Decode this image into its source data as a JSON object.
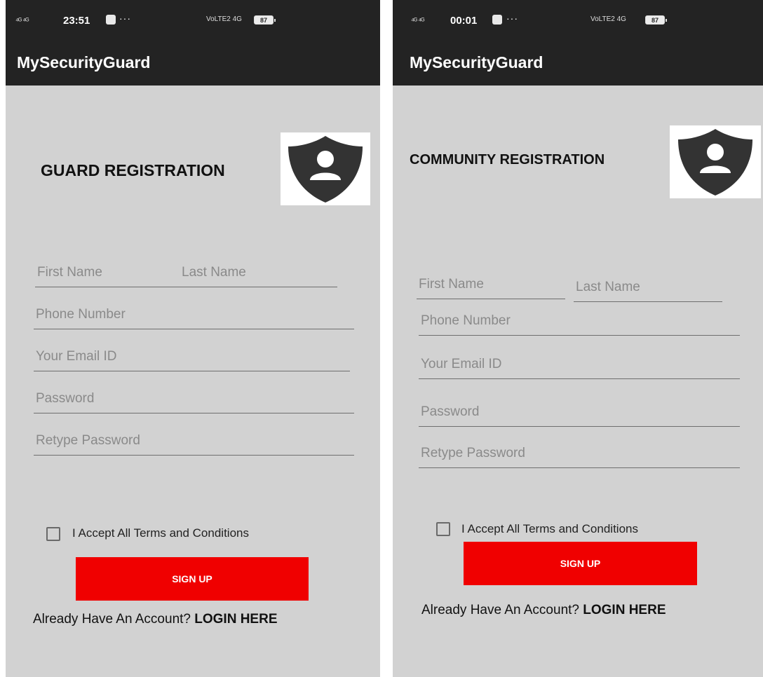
{
  "screens": [
    {
      "status": {
        "signal_left": "⁴ᴳ ⁴ᴳ",
        "time": "23:51",
        "dots": "···",
        "network": "VoLTE2 4G",
        "battery": "87"
      },
      "app_title": "MySecurityGuard",
      "heading": "GUARD REGISTRATION",
      "fields": {
        "first_name": "First Name",
        "last_name": "Last Name",
        "phone": "Phone Number",
        "email": "Your Email ID",
        "password": "Password",
        "retype": "Retype Password"
      },
      "terms": "I Accept All Terms and Conditions",
      "signup": "SIGN UP",
      "account_prompt": "Already Have An Account?",
      "login": "LOGIN HERE"
    },
    {
      "status": {
        "signal_left": "⁴ᴳ ⁴ᴳ",
        "time": "00:01",
        "dots": "···",
        "network": "VoLTE2 4G",
        "battery": "87"
      },
      "app_title": "MySecurityGuard",
      "heading": "COMMUNITY REGISTRATION",
      "fields": {
        "first_name": "First Name",
        "last_name": "Last Name",
        "phone": "Phone Number",
        "email": "Your Email ID",
        "password": "Password",
        "retype": "Retype Password"
      },
      "terms": "I Accept All Terms and Conditions",
      "signup": "SIGN UP",
      "account_prompt": "Already Have An Account?",
      "login": "LOGIN HERE"
    }
  ],
  "colors": {
    "appbar": "#232323",
    "background": "#d2d2d2",
    "button": "#f00000",
    "shield": "#333333"
  },
  "icons": {
    "logo": "shield-user-icon",
    "checkbox": "checkbox-unchecked-icon"
  }
}
